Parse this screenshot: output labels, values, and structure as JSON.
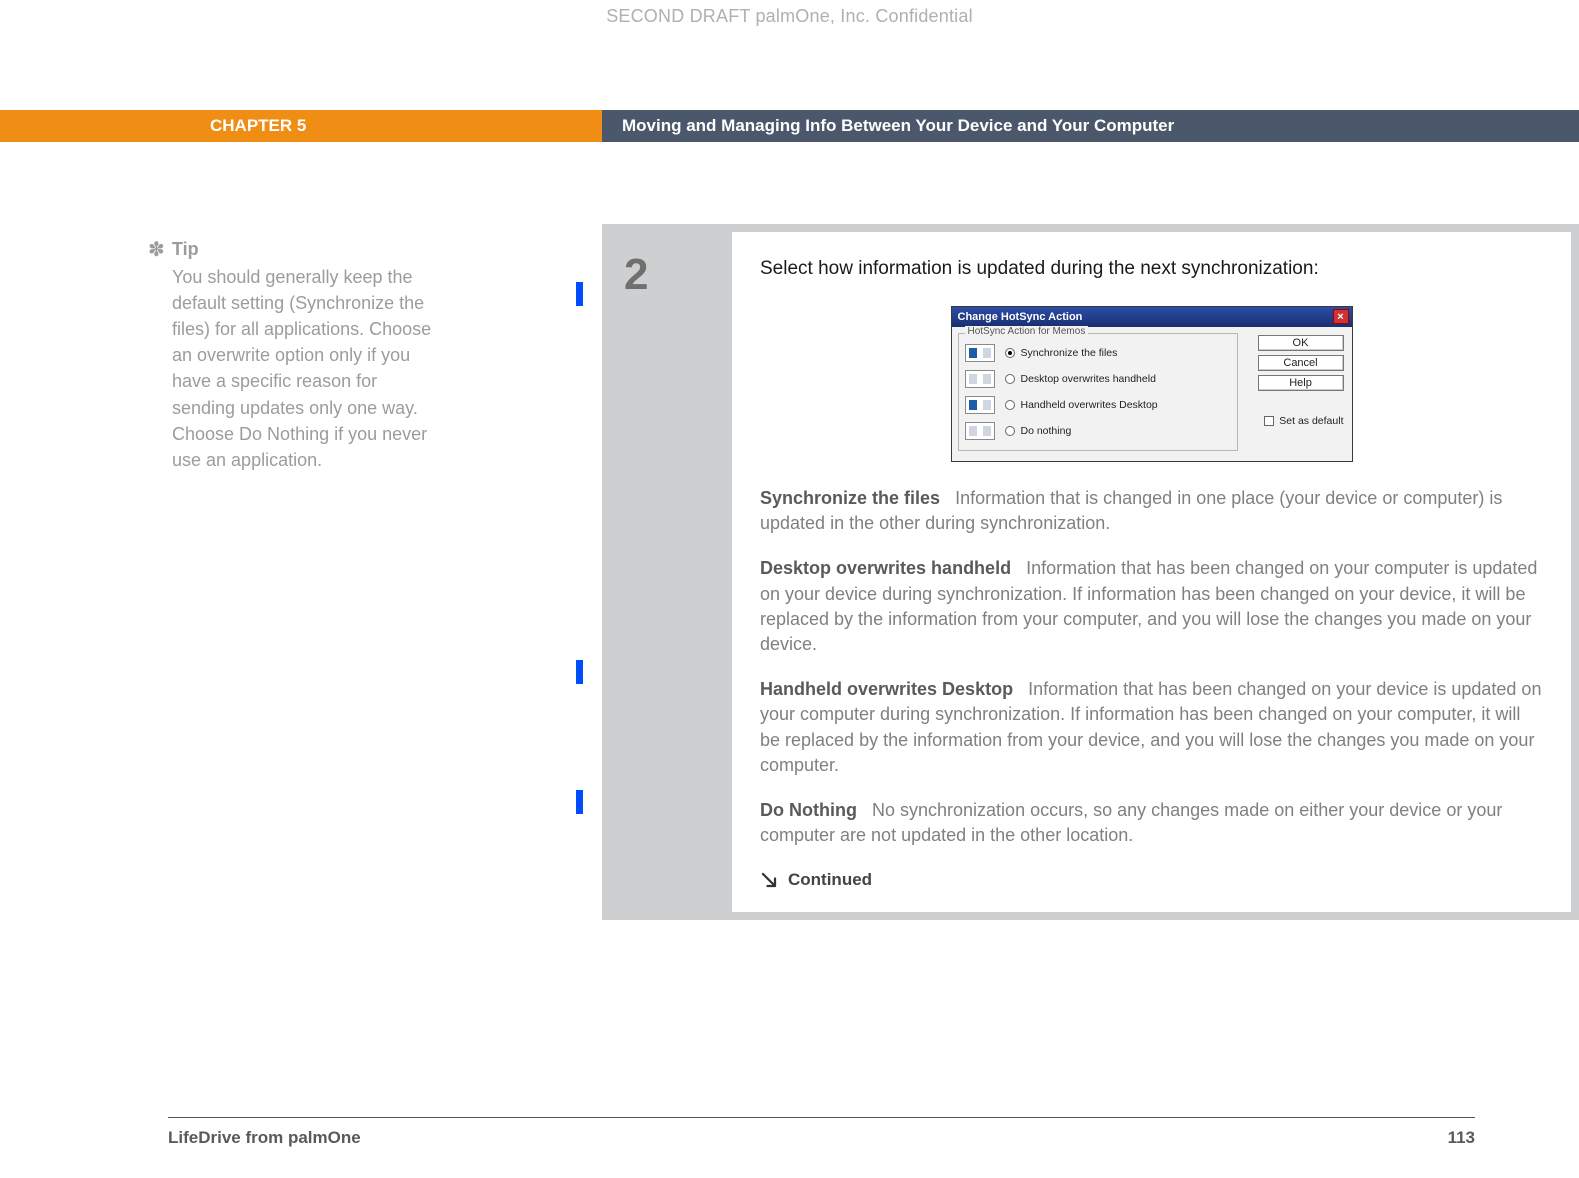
{
  "header": {
    "confidential": "SECOND DRAFT palmOne, Inc.  Confidential"
  },
  "banner": {
    "chapter": "CHAPTER 5",
    "title": "Moving and Managing Info Between Your Device and Your Computer"
  },
  "tip": {
    "label": "Tip",
    "body": "You should generally keep the default setting (Synchronize the files) for all applications. Choose an overwrite option only if you have a specific reason for sending updates only one way. Choose Do Nothing if you never use an application."
  },
  "step": {
    "number": "2",
    "lead": "Select how information is updated during the next synchronization:",
    "dialog": {
      "title": "Change HotSync Action",
      "legend": "HotSync Action for Memos",
      "options": {
        "sync": "Synchronize the files",
        "desktop": "Desktop overwrites handheld",
        "handheld": "Handheld overwrites Desktop",
        "nothing": "Do nothing"
      },
      "buttons": {
        "ok": "OK",
        "cancel": "Cancel",
        "help": "Help"
      },
      "set_default": "Set as default"
    },
    "descriptions": {
      "sync_label": "Synchronize the files",
      "sync_text": "Information that is changed in one place (your device or computer) is updated in the other during synchronization.",
      "desktop_label": "Desktop overwrites handheld",
      "desktop_text": "Information that has been changed on your computer is updated on your device during synchronization. If information has been changed on your device, it will be replaced by the information from your computer, and you will lose the changes you made on your device.",
      "handheld_label": "Handheld overwrites Desktop",
      "handheld_text": "Information that has been changed on your device is updated on your computer during synchronization. If information has been changed on your computer, it will be replaced by the information from your device, and you will lose the changes you made on your computer.",
      "nothing_label": "Do Nothing",
      "nothing_text": "No synchronization occurs, so any changes made on either your device or your computer are not updated in the other location."
    },
    "continued": "Continued"
  },
  "footer": {
    "product": "LifeDrive from palmOne",
    "page": "113"
  }
}
